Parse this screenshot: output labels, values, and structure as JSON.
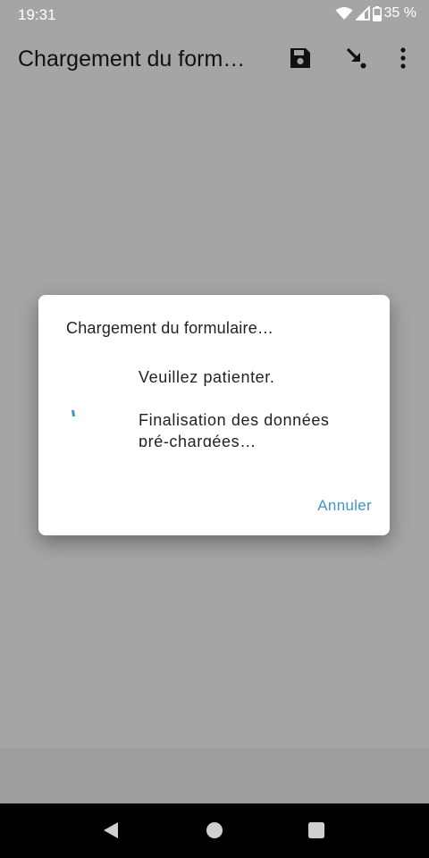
{
  "status_bar": {
    "time": "19:31",
    "battery": "35 %",
    "icons": [
      "wifi-icon",
      "cell-signal-icon",
      "battery-icon"
    ]
  },
  "app_bar": {
    "title": "Chargement du form…",
    "actions": [
      "save-icon",
      "download-arrow-icon",
      "more-vertical-icon"
    ]
  },
  "dialog": {
    "title": "Chargement du formulaire…",
    "message": "Veuillez patienter.\n\nFinalisation des données pré-chargées…",
    "cancel_label": "Annuler"
  },
  "nav_bar": {
    "icons": [
      "back-icon",
      "home-icon",
      "recents-icon"
    ]
  },
  "colors": {
    "accent": "#3f97c4",
    "scrim_background": "#a5a5a5",
    "dialog_background": "#ffffff"
  }
}
